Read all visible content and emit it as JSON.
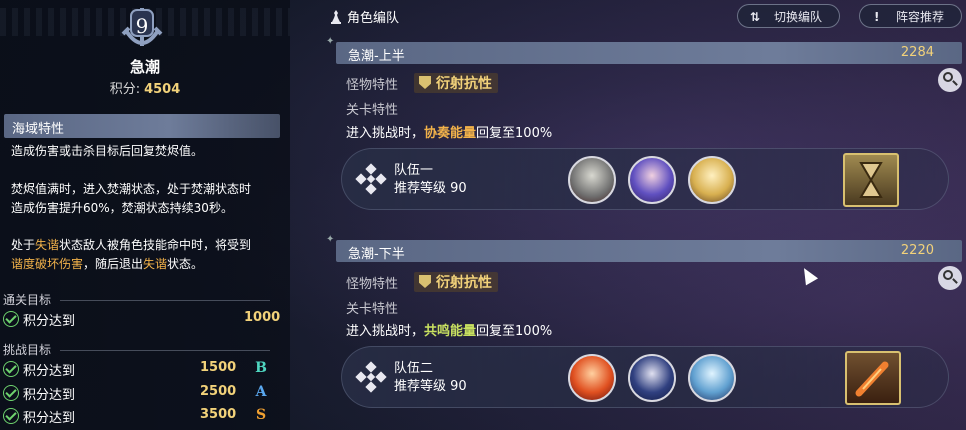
{
  "stage": {
    "level": "9",
    "name": "急潮",
    "score_label": "积分:",
    "score_value": "4504"
  },
  "sea_trait": {
    "header": "海域特性",
    "p1": "造成伤害或击杀目标后回复焚烬值。",
    "p2_line1": "焚烬值满时，进入焚潮状态，处于焚潮状态时",
    "p2_line2": "造成伤害提升60%，焚潮状态持续30秒。",
    "p3_line1_a": "处于",
    "p3_line1_hl": "失谐",
    "p3_line1_b": "状态敌人被角色技能命中时，将受到",
    "p3_line2_hl1": "谐度破坏伤害",
    "p3_line2_b": "，随后退出",
    "p3_line2_hl2": "失谐",
    "p3_line2_c": "状态。"
  },
  "clear_goal": {
    "header": "通关目标",
    "label": "积分达到",
    "value": "1000"
  },
  "challenge_goals": {
    "header": "挑战目标",
    "items": [
      {
        "label": "积分达到",
        "value": "1500",
        "grade": "B",
        "color": "#4fd6c0"
      },
      {
        "label": "积分达到",
        "value": "2500",
        "grade": "A",
        "color": "#5aa8f0"
      },
      {
        "label": "积分达到",
        "value": "3500",
        "grade": "S",
        "color": "#f0a030"
      }
    ]
  },
  "header": {
    "title": "角色编队",
    "switch_label": "切换编队",
    "recommend_label": "阵容推荐"
  },
  "sections": [
    {
      "title": "急潮-上半",
      "score": "2284",
      "monster_label": "怪物特性",
      "trait": "衍射抗性",
      "stage_label": "关卡特性",
      "desc_a": "进入挑战时，",
      "desc_hl": "协奏能量",
      "desc_b": "回复至100%",
      "team_name": "队伍一",
      "team_level": "推荐等级 90"
    },
    {
      "title": "急潮-下半",
      "score": "2220",
      "monster_label": "怪物特性",
      "trait": "衍射抗性",
      "stage_label": "关卡特性",
      "desc_a": "进入挑战时，",
      "desc_hl": "共鸣能量",
      "desc_b": "回复至100%",
      "team_name": "队伍二",
      "team_level": "推荐等级 90"
    }
  ]
}
